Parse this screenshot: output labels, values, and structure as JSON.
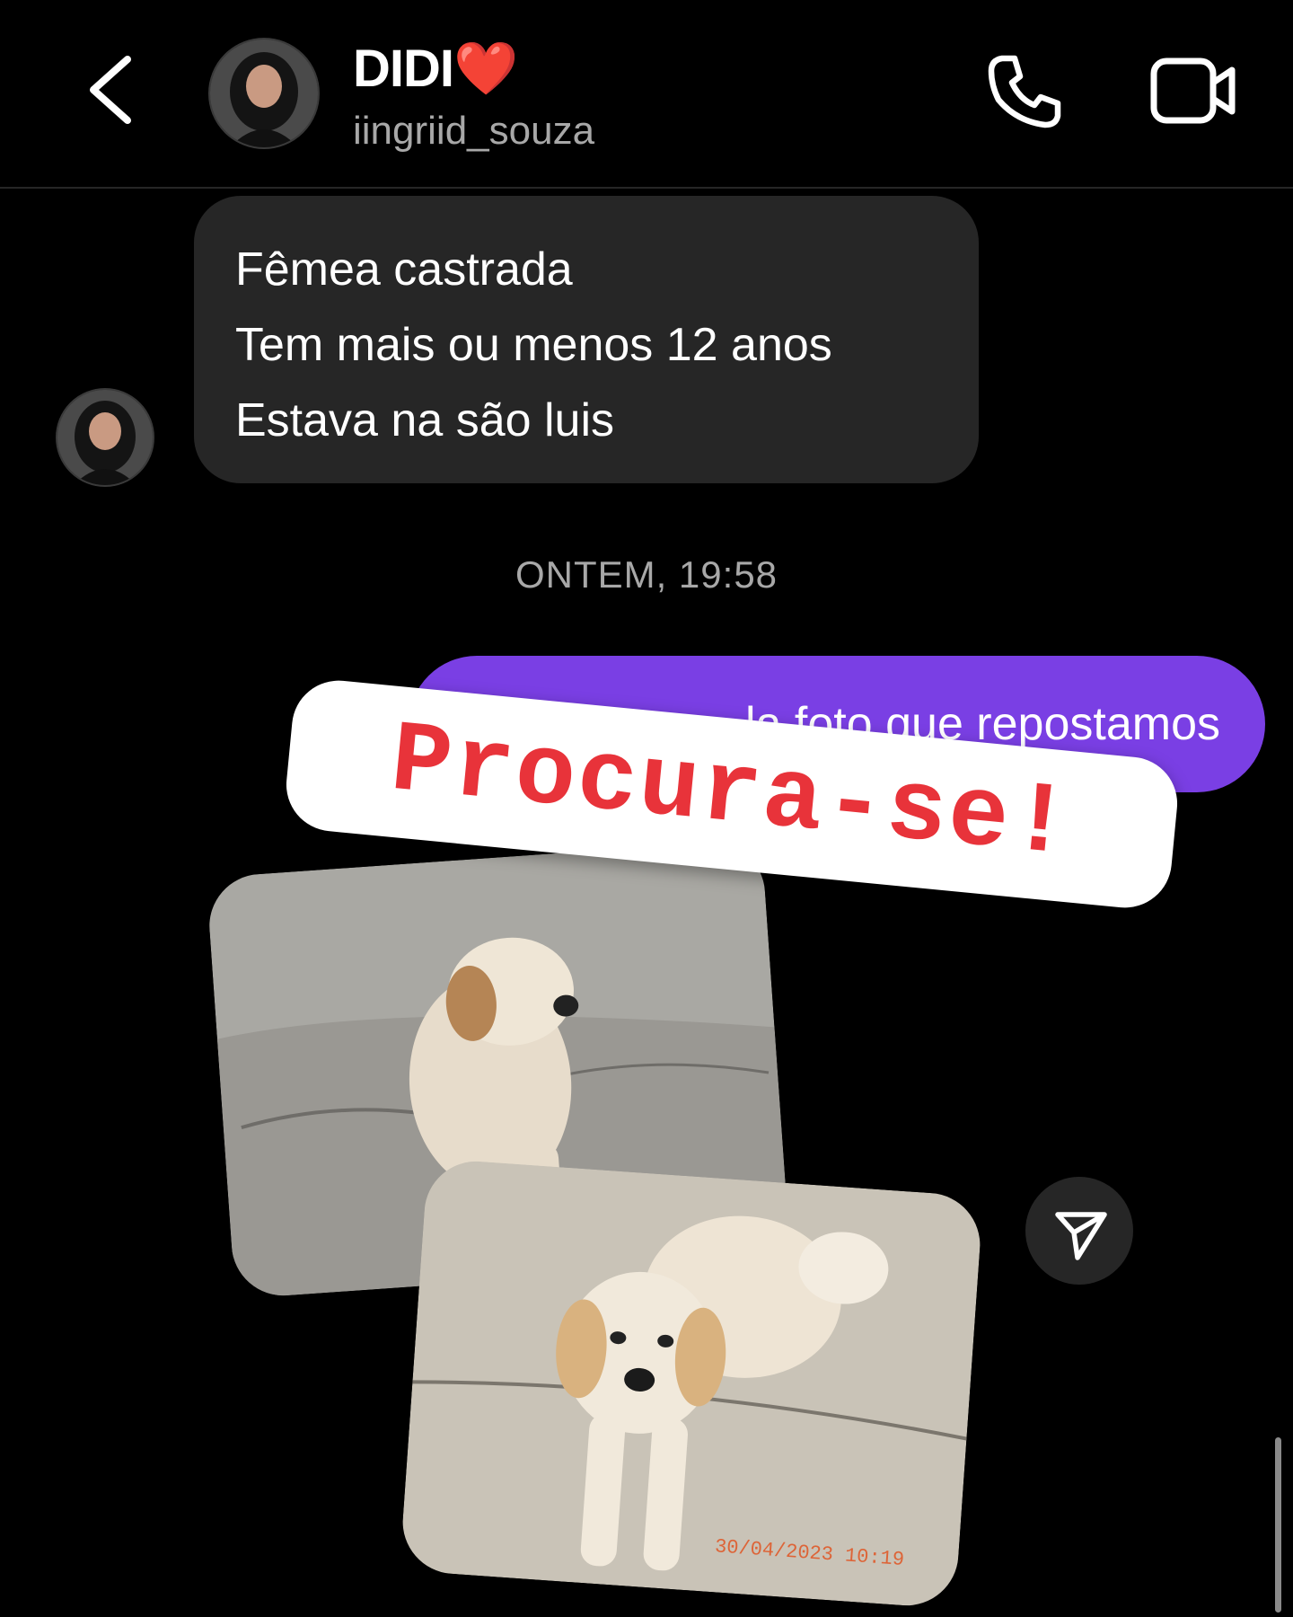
{
  "header": {
    "contact_name": "DIDI",
    "name_emoji": "❤️",
    "contact_handle": "iingriid_souza",
    "icons": {
      "back": "back-icon",
      "call": "phone-icon",
      "video": "video-call-icon"
    }
  },
  "messages": {
    "received": {
      "lines": [
        "Fêmea castrada",
        "Tem mais ou menos 12 anos",
        "Estava na são luis"
      ]
    },
    "timestamp": "ONTEM, 19:58",
    "sent": {
      "visible_text": "la foto que repostamos"
    },
    "story": {
      "sticker_text": "Procura-se!",
      "photo_stamp": "30/04/2023 10:19"
    }
  },
  "colors": {
    "background": "#000000",
    "bubble_in": "#262626",
    "bubble_out": "#7a3fe4",
    "sticker_text": "#e8333a",
    "muted_text": "#a8a8a8"
  }
}
